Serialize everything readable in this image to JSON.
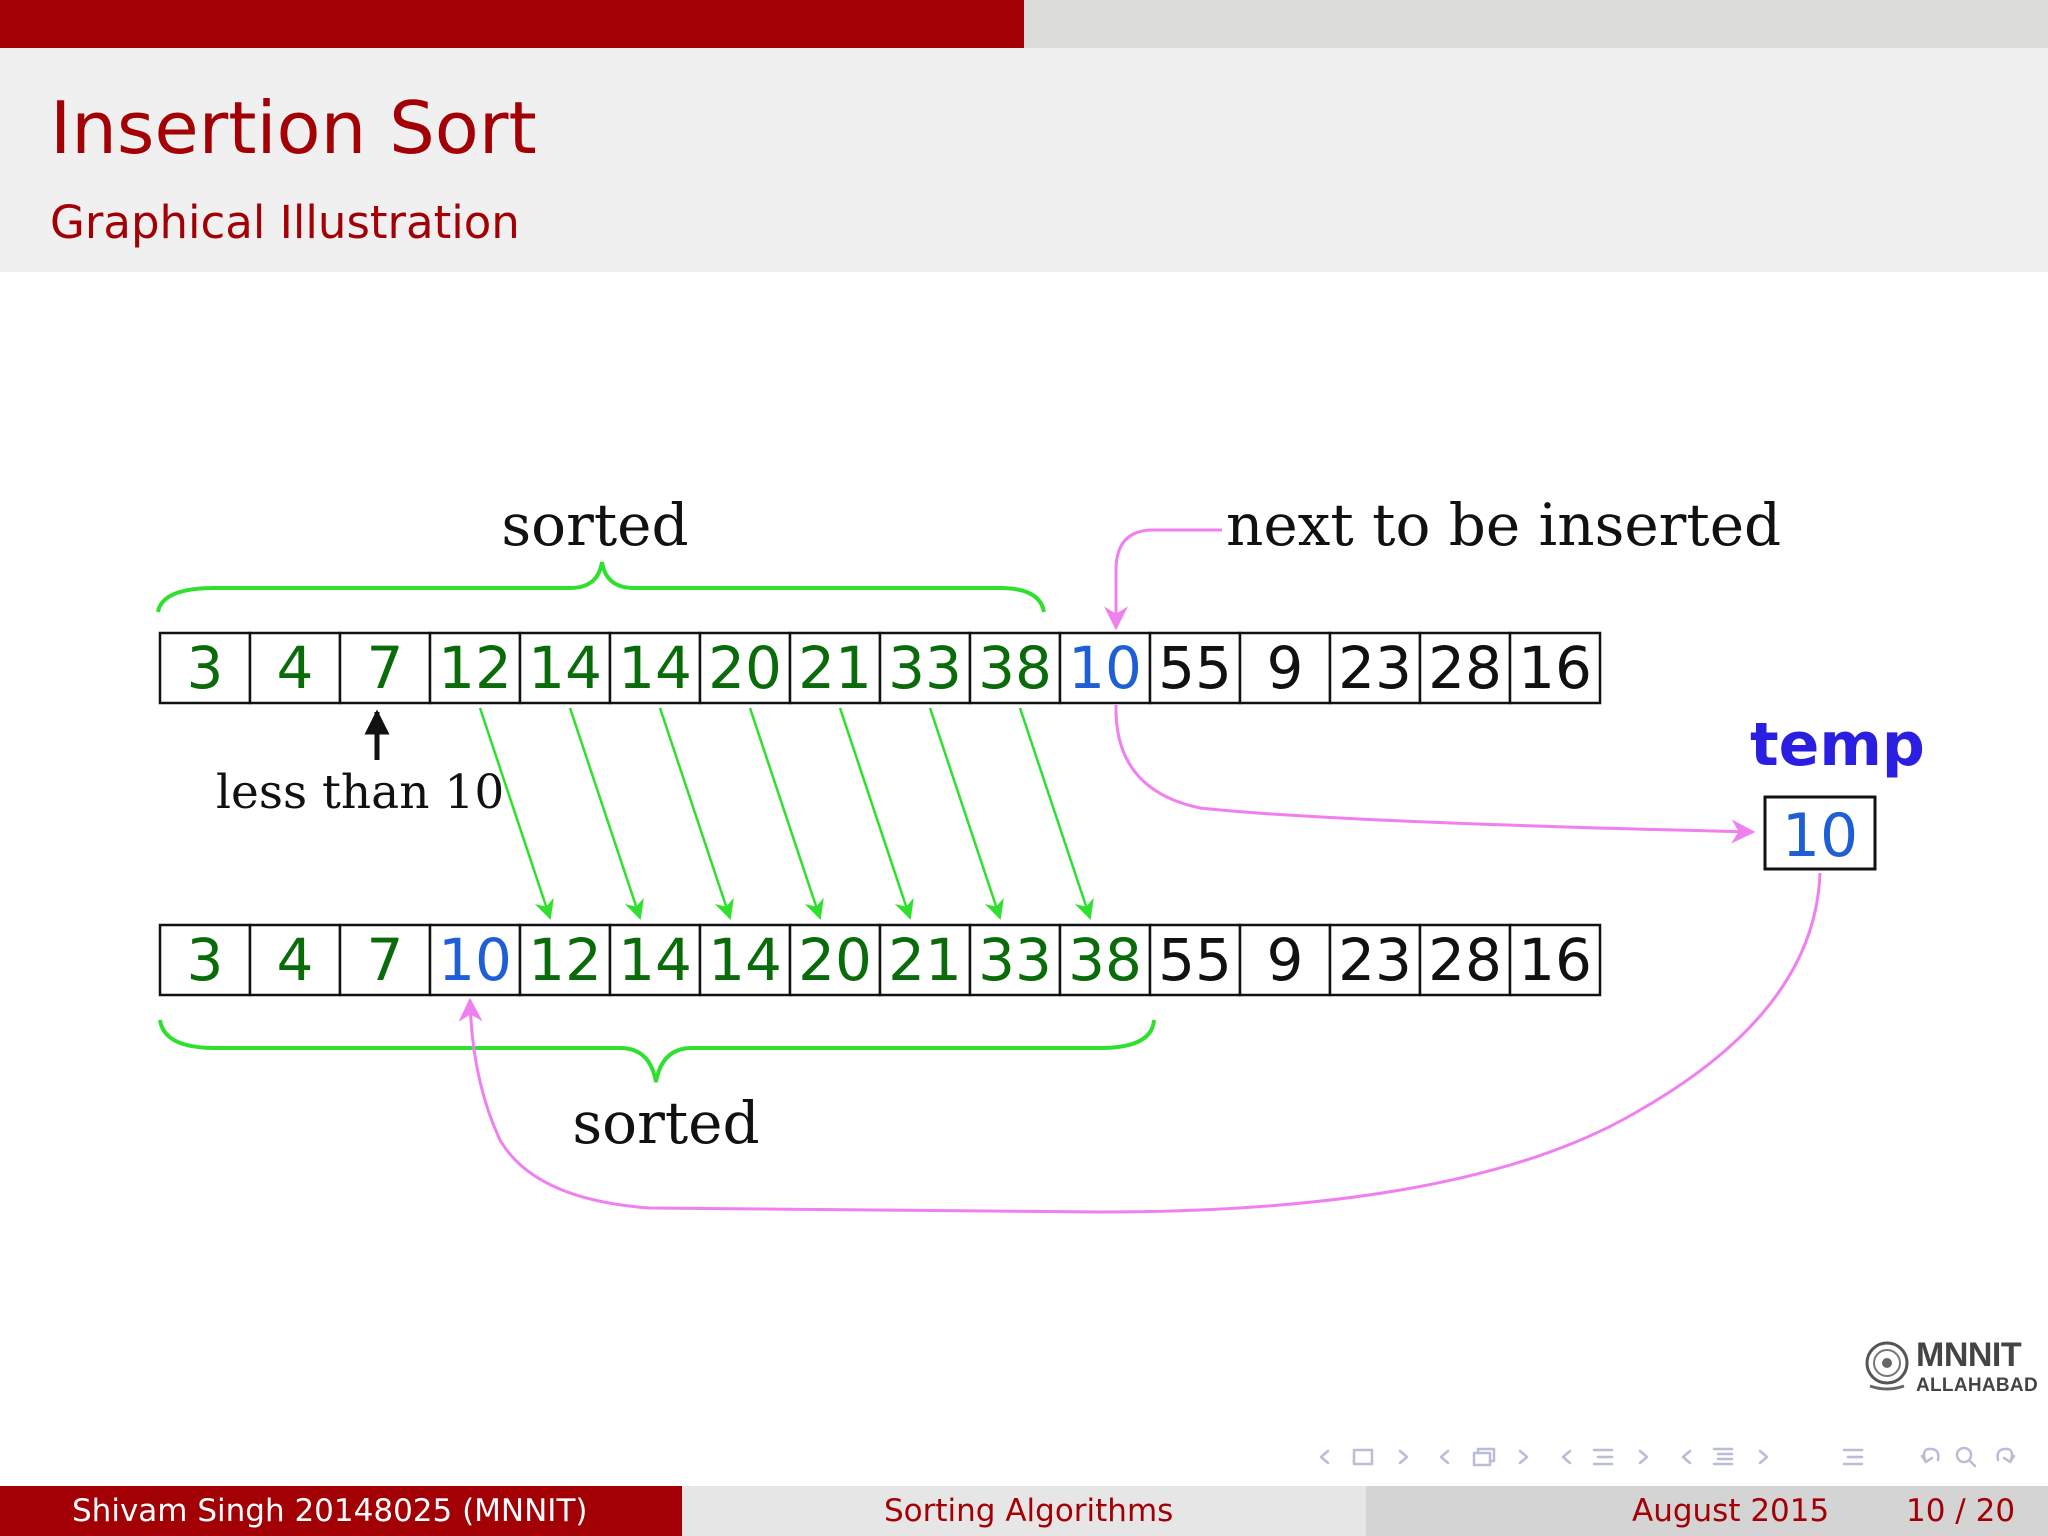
{
  "slide": {
    "title": "Insertion Sort",
    "subtitle": "Graphical Illustration"
  },
  "diagram": {
    "labels": {
      "sorted_top": "sorted",
      "sorted_bottom": "sorted",
      "next_to_insert": "next to be inserted",
      "less_than": "less than  10",
      "temp_label": "temp",
      "temp_value": "10"
    },
    "top_row": [
      {
        "v": "3",
        "c": "green"
      },
      {
        "v": "4",
        "c": "green"
      },
      {
        "v": "7",
        "c": "green"
      },
      {
        "v": "12",
        "c": "green"
      },
      {
        "v": "14",
        "c": "green"
      },
      {
        "v": "14",
        "c": "green"
      },
      {
        "v": "20",
        "c": "green"
      },
      {
        "v": "21",
        "c": "green"
      },
      {
        "v": "33",
        "c": "green"
      },
      {
        "v": "38",
        "c": "green"
      },
      {
        "v": "10",
        "c": "blue"
      },
      {
        "v": "55",
        "c": "black"
      },
      {
        "v": "9",
        "c": "black"
      },
      {
        "v": "23",
        "c": "black"
      },
      {
        "v": "28",
        "c": "black"
      },
      {
        "v": "16",
        "c": "black"
      }
    ],
    "bottom_row": [
      {
        "v": "3",
        "c": "green"
      },
      {
        "v": "4",
        "c": "green"
      },
      {
        "v": "7",
        "c": "green"
      },
      {
        "v": "10",
        "c": "blue"
      },
      {
        "v": "12",
        "c": "green"
      },
      {
        "v": "14",
        "c": "green"
      },
      {
        "v": "14",
        "c": "green"
      },
      {
        "v": "20",
        "c": "green"
      },
      {
        "v": "21",
        "c": "green"
      },
      {
        "v": "33",
        "c": "green"
      },
      {
        "v": "38",
        "c": "green"
      },
      {
        "v": "55",
        "c": "black"
      },
      {
        "v": "9",
        "c": "black"
      },
      {
        "v": "23",
        "c": "black"
      },
      {
        "v": "28",
        "c": "black"
      },
      {
        "v": "16",
        "c": "black"
      }
    ],
    "colors": {
      "green": "#0a6b0a",
      "blue": "#1f5fd6",
      "black": "#111111",
      "brace": "#2fe02f",
      "arrow_green": "#2fe02f",
      "arrow_pink": "#f07ff0",
      "temp_label": "#2a1fe0"
    }
  },
  "logo": {
    "name": "MNNIT",
    "sub": "ALLAHABAD"
  },
  "footer": {
    "author": "Shivam Singh  20148025  (MNNIT)",
    "topic": "Sorting Algorithms",
    "date": "August 2015",
    "page": "10 / 20"
  },
  "theme": {
    "accent": "#a30006",
    "header_bg": "#f0f0f0"
  }
}
